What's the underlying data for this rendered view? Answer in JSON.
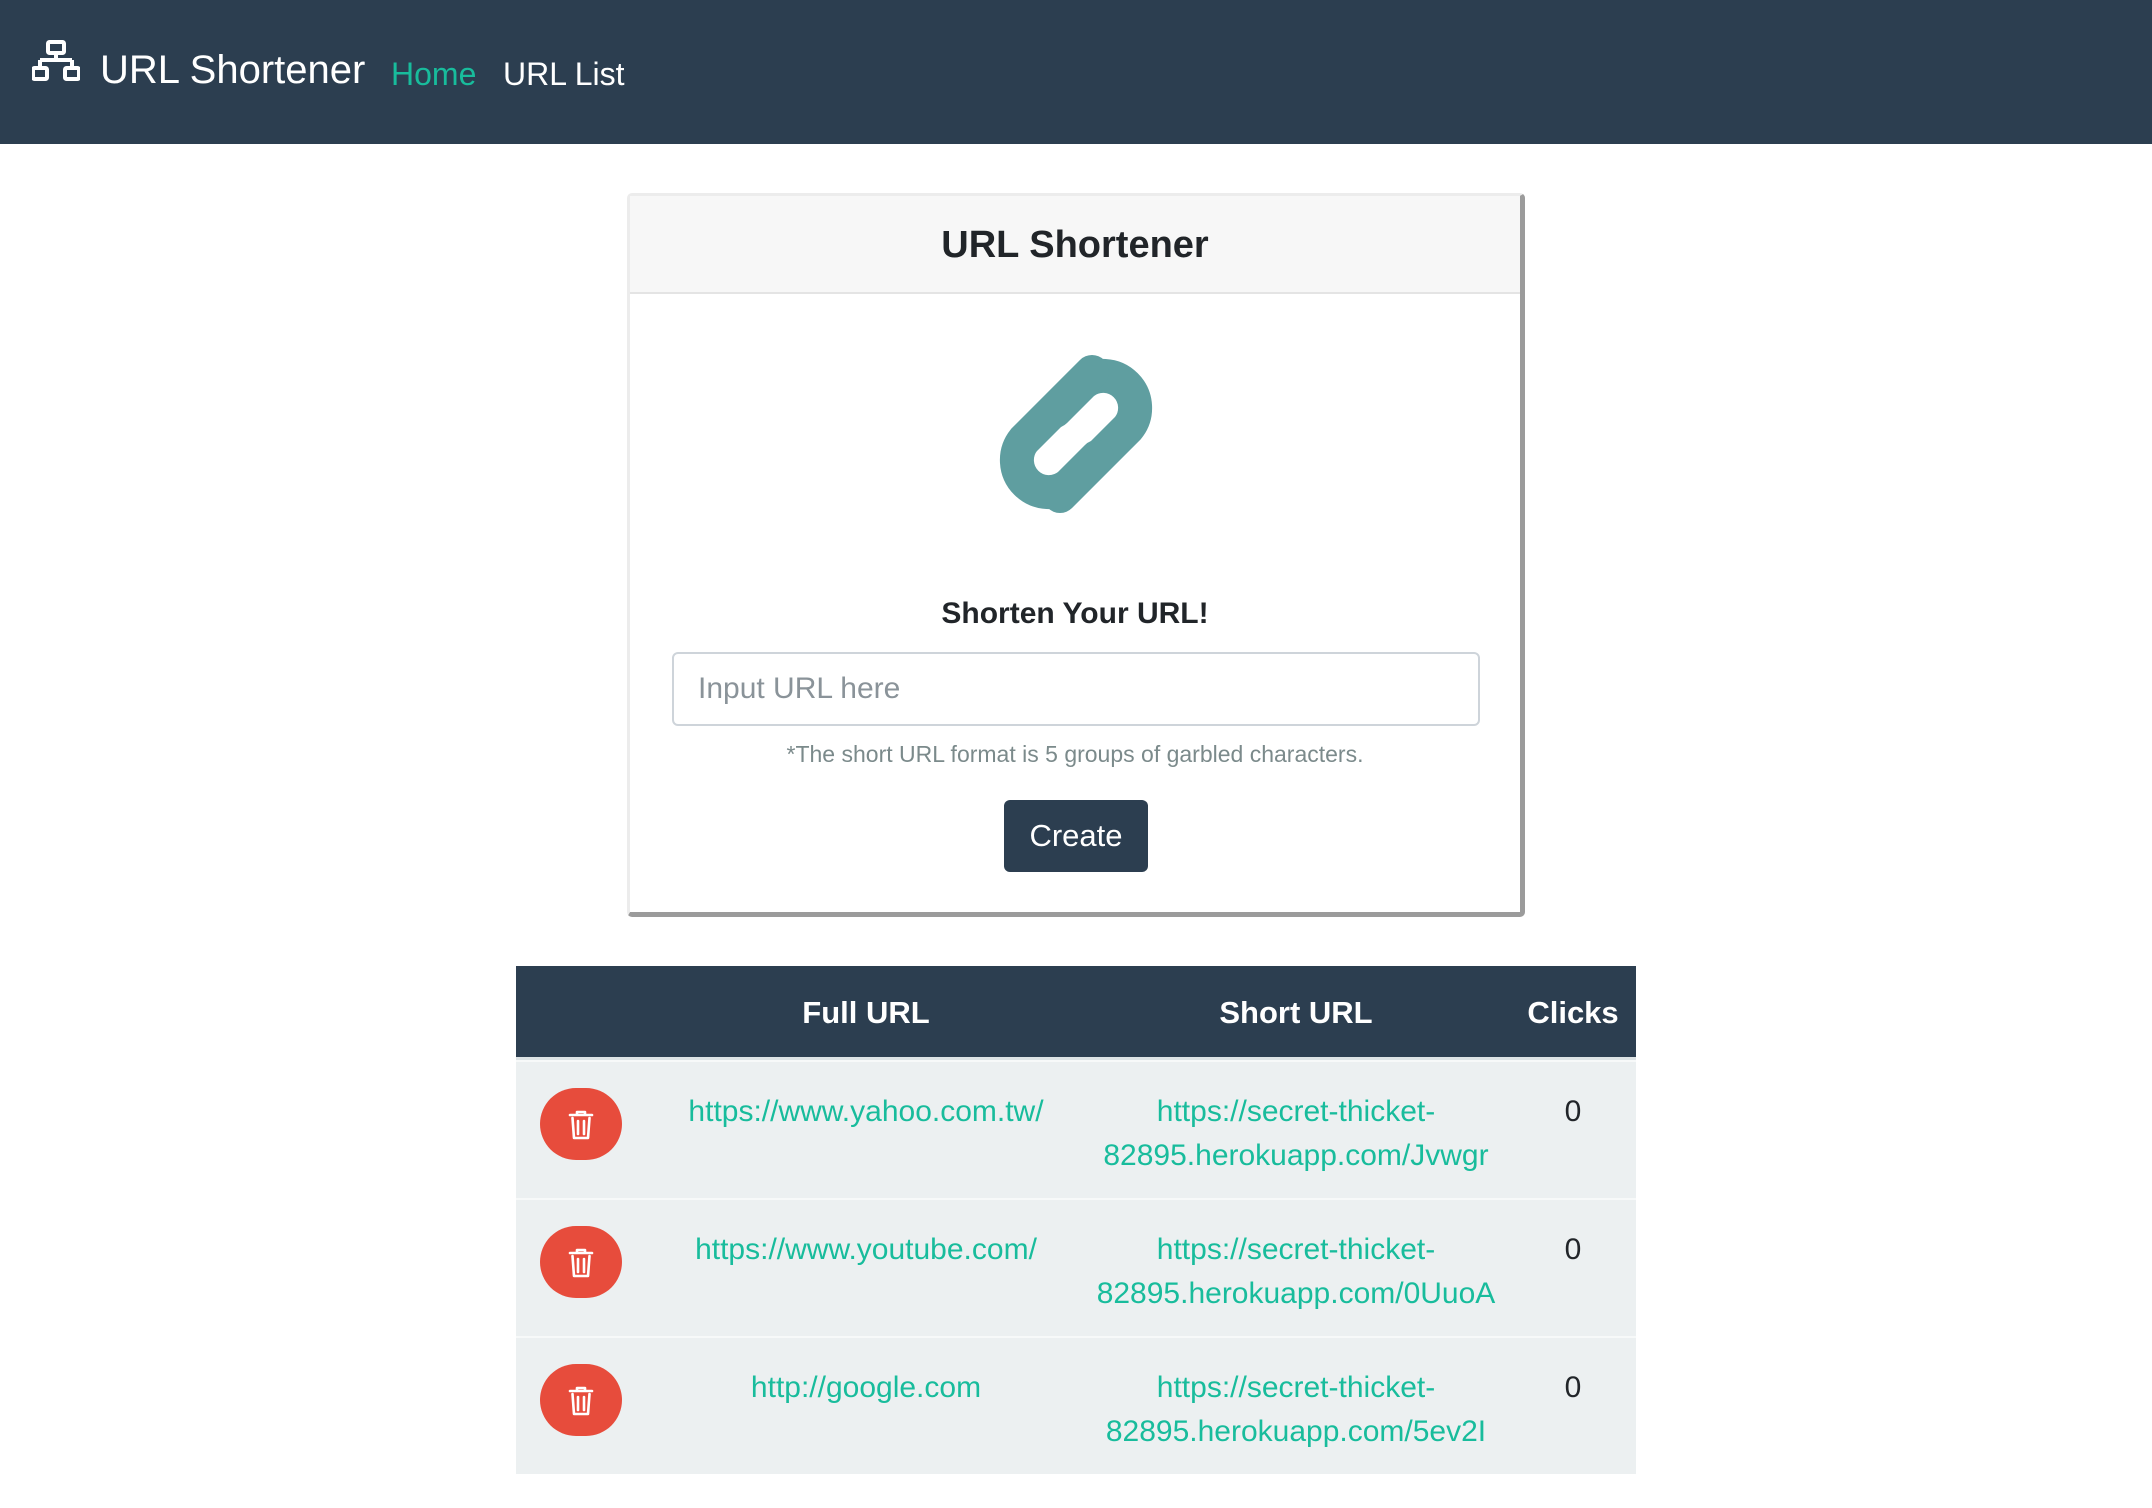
{
  "navbar": {
    "brand_icon": "sitemap-icon",
    "brand": "URL Shortener",
    "links": [
      {
        "label": "Home",
        "active": true
      },
      {
        "label": "URL List",
        "active": false
      }
    ]
  },
  "card": {
    "header": "URL Shortener",
    "icon": "link-icon",
    "icon_color": "#5f9ea0",
    "subtitle": "Shorten Your URL!",
    "input": {
      "placeholder": "Input URL here",
      "value": ""
    },
    "hint": "*The short URL format is 5 groups of garbled characters.",
    "button": "Create"
  },
  "table": {
    "headers": {
      "delete": "",
      "full_url": "Full URL",
      "short_url": "Short URL",
      "clicks": "Clicks"
    },
    "rows": [
      {
        "full_url": "https://www.yahoo.com.tw/",
        "short_url_line1": "https://secret-thicket-",
        "short_url_line2": "82895.herokuapp.com/Jvwgr",
        "clicks": "0"
      },
      {
        "full_url": "https://www.youtube.com/",
        "short_url_line1": "https://secret-thicket-",
        "short_url_line2": "82895.herokuapp.com/0UuoA",
        "clicks": "0"
      },
      {
        "full_url": "http://google.com",
        "short_url_line1": "https://secret-thicket-",
        "short_url_line2": "82895.herokuapp.com/5ev2I",
        "clicks": "0"
      }
    ]
  },
  "colors": {
    "navbar": "#2c3e50",
    "accent": "#18bc9c",
    "danger": "#e74c3c",
    "row_bg": "#ecf0f1"
  }
}
